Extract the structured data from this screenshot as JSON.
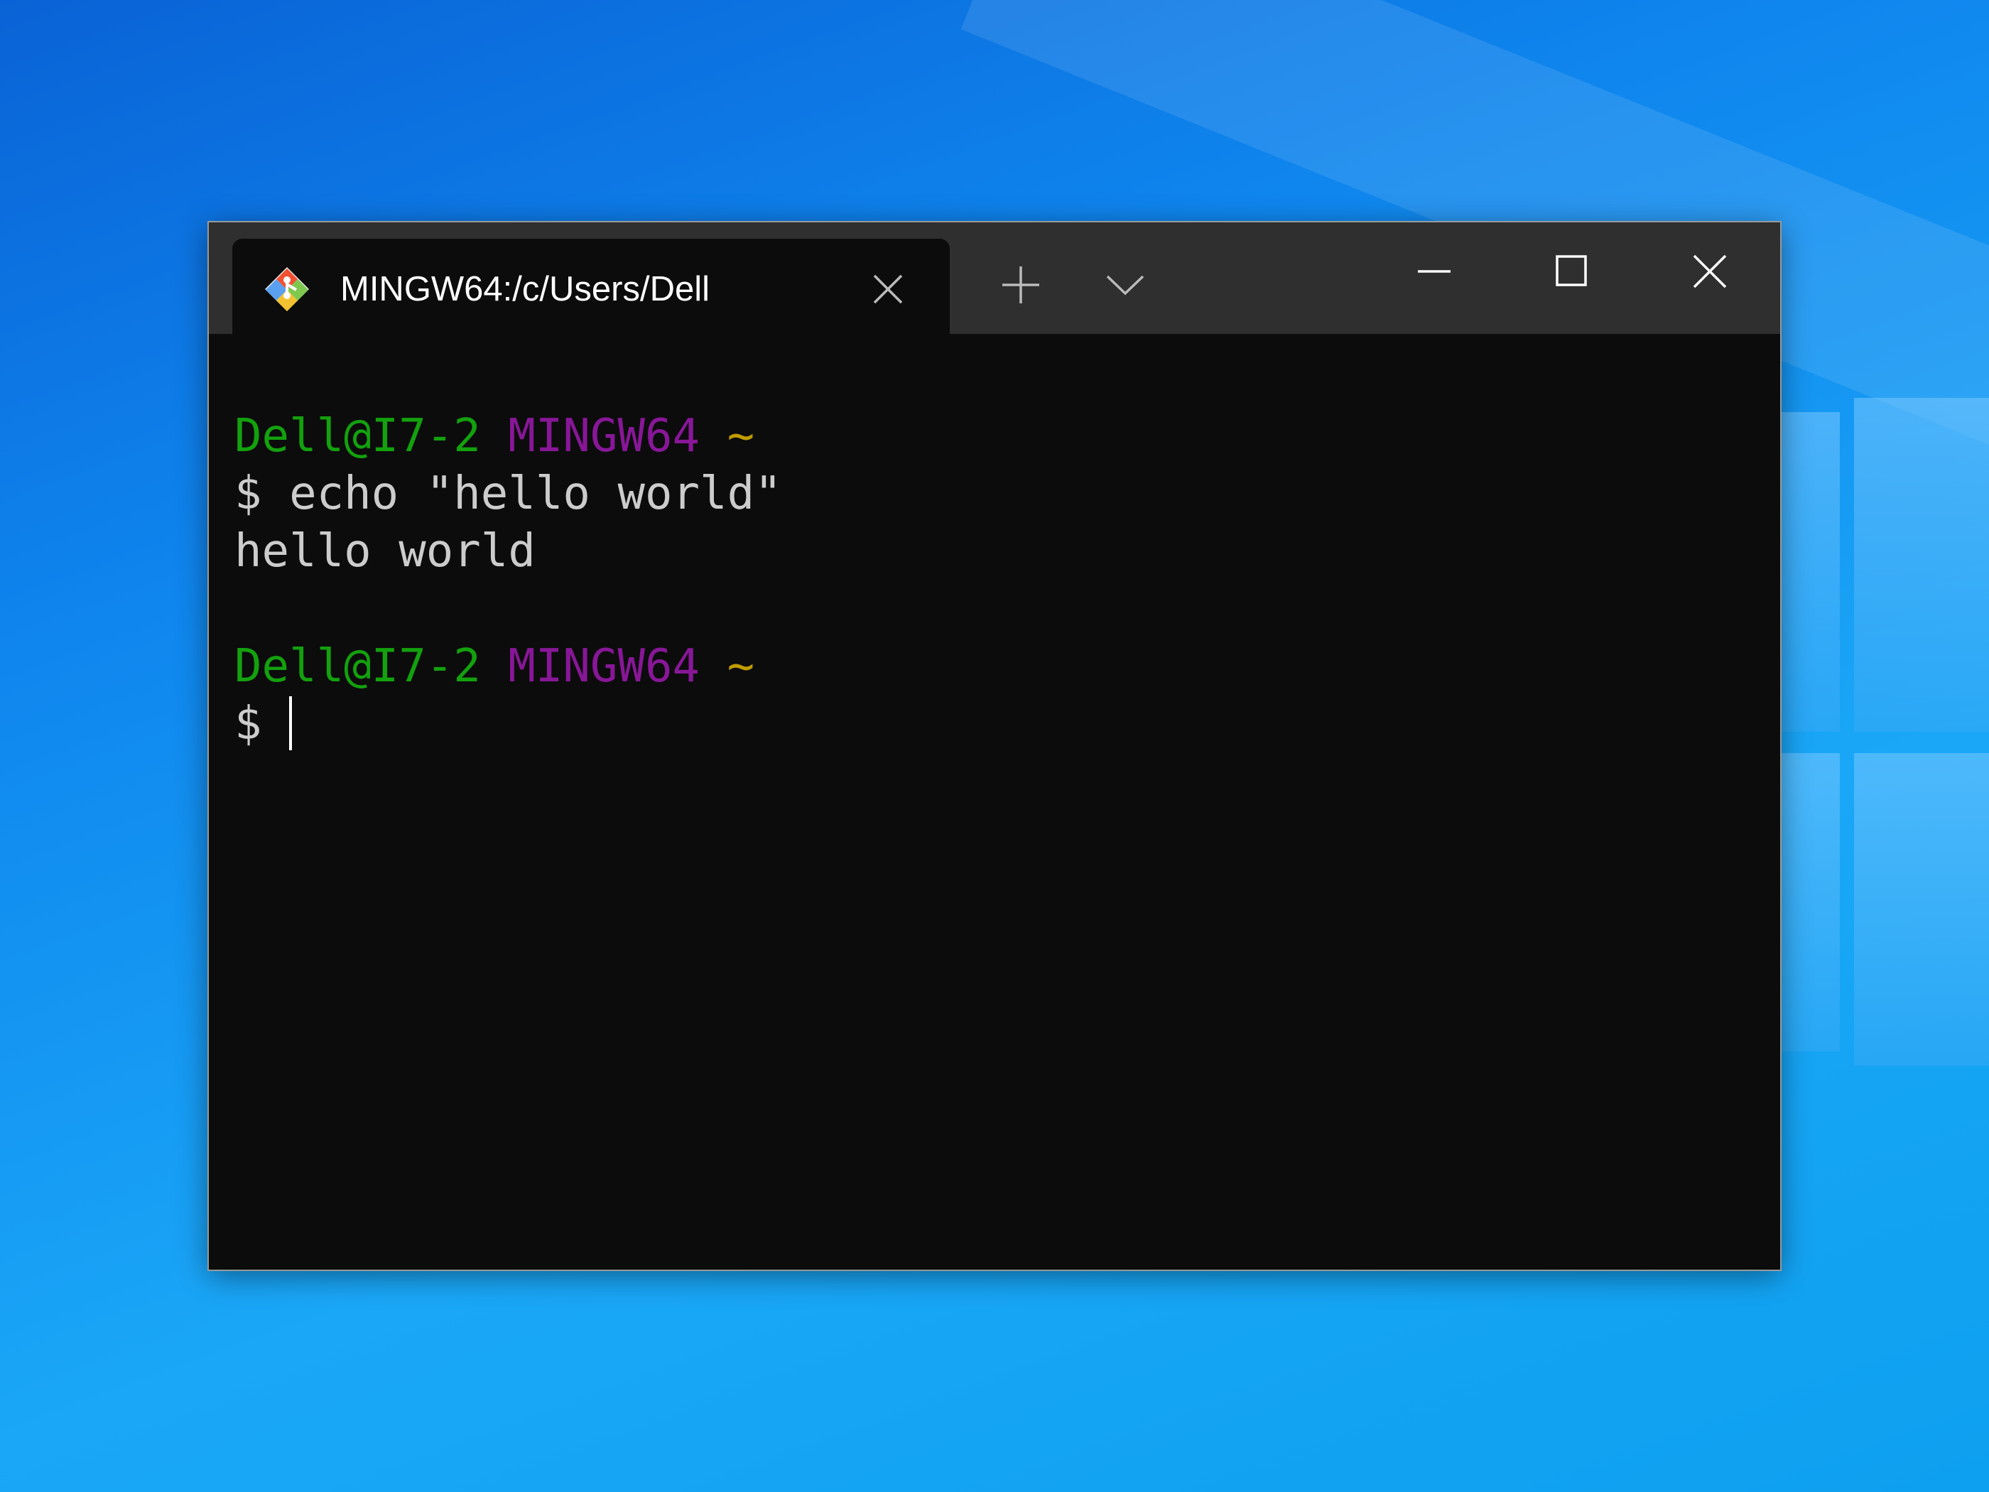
{
  "window": {
    "tab_title": "MINGW64:/c/Users/Dell"
  },
  "icons": {
    "tab_icon": "git-bash-icon",
    "tab_close": "close-icon",
    "new_tab": "plus-icon",
    "dropdown": "chevron-down-icon",
    "minimize": "minimize-icon",
    "maximize": "maximize-icon",
    "close": "close-icon"
  },
  "terminal": {
    "prompt1": {
      "user_host": "Dell@I7-2",
      "system": "MINGW64",
      "path": "~"
    },
    "command_line": "$ echo \"hello world\"",
    "output": "hello world",
    "prompt2": {
      "user_host": "Dell@I7-2",
      "system": "MINGW64",
      "path": "~"
    },
    "current_prompt": "$ "
  },
  "colors": {
    "desktop_blue": "#0f86ee",
    "terminal_bg": "#0c0c0c",
    "titlebar_bg": "#2f2f2f",
    "prompt_green": "#13a10e",
    "prompt_purple": "#881798",
    "prompt_yellow": "#c19c00",
    "text": "#cccccc"
  }
}
